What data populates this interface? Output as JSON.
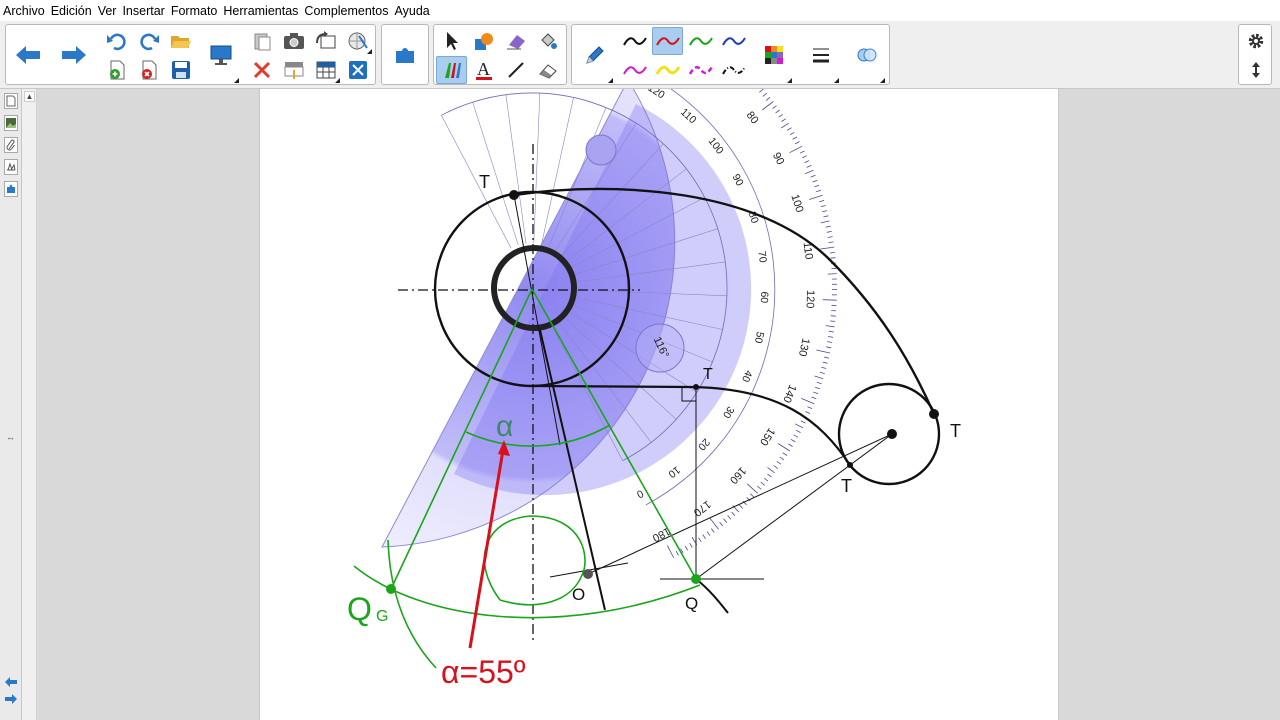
{
  "menu": [
    "Archivo",
    "Edición",
    "Ver",
    "Insertar",
    "Formato",
    "Herramientas",
    "Complementos",
    "Ayuda"
  ],
  "colors": {
    "accent": "#a9cdee",
    "green": "#1aa51a",
    "red": "#d8101c",
    "protractor": "#7a6ff0"
  },
  "icons": {
    "back": "arrow-left-icon",
    "forward": "arrow-right-icon",
    "undo": "undo-icon",
    "redo": "redo-icon",
    "open": "folder-open-icon",
    "new_page": "add-page-icon",
    "delete_page": "delete-page-icon",
    "save": "save-icon",
    "display": "screen-icon",
    "paste": "paste-icon",
    "screenshot": "camera-icon",
    "capture": "capture-icon",
    "measure": "measurement-tools-icon",
    "delete": "delete-icon",
    "screen_shade": "screen-shade-icon",
    "table": "table-icon",
    "fit": "fit-screen-icon",
    "addons": "puzzle-icon",
    "select": "select-icon",
    "shapes": "shapes-icon",
    "eraser": "eraser-icon",
    "fill": "fill-icon",
    "pens": "creative-pens-icon",
    "text": "text-icon",
    "line": "line-icon",
    "magic_eraser": "magic-eraser-icon",
    "pen": "pen-icon",
    "colors": "color-palette-icon",
    "line_props": "line-properties-icon",
    "fill_props": "fill-properties-icon",
    "settings": "gear-icon",
    "move_toolbar": "move-toolbar-icon"
  },
  "drawing": {
    "labels": {
      "T1": "T",
      "T2": "T",
      "T3": "T",
      "T4": "T",
      "O": "O",
      "Q": "Q",
      "QG_main": "Q",
      "QG_sub": "G",
      "alpha": "α",
      "alpha_value": "α=55º",
      "angle_readout": "116°"
    },
    "protractor_outer": [
      "0",
      "10",
      "20",
      "30",
      "40",
      "50",
      "60",
      "70",
      "80",
      "90",
      "100",
      "110",
      "120",
      "130",
      "140",
      "150",
      "160",
      "170",
      "180"
    ],
    "protractor_inner": [
      "180",
      "170",
      "160",
      "150",
      "140",
      "130",
      "120",
      "110",
      "100",
      "90",
      "80",
      "70",
      "60",
      "50",
      "40",
      "30",
      "20",
      "10",
      "0"
    ]
  }
}
